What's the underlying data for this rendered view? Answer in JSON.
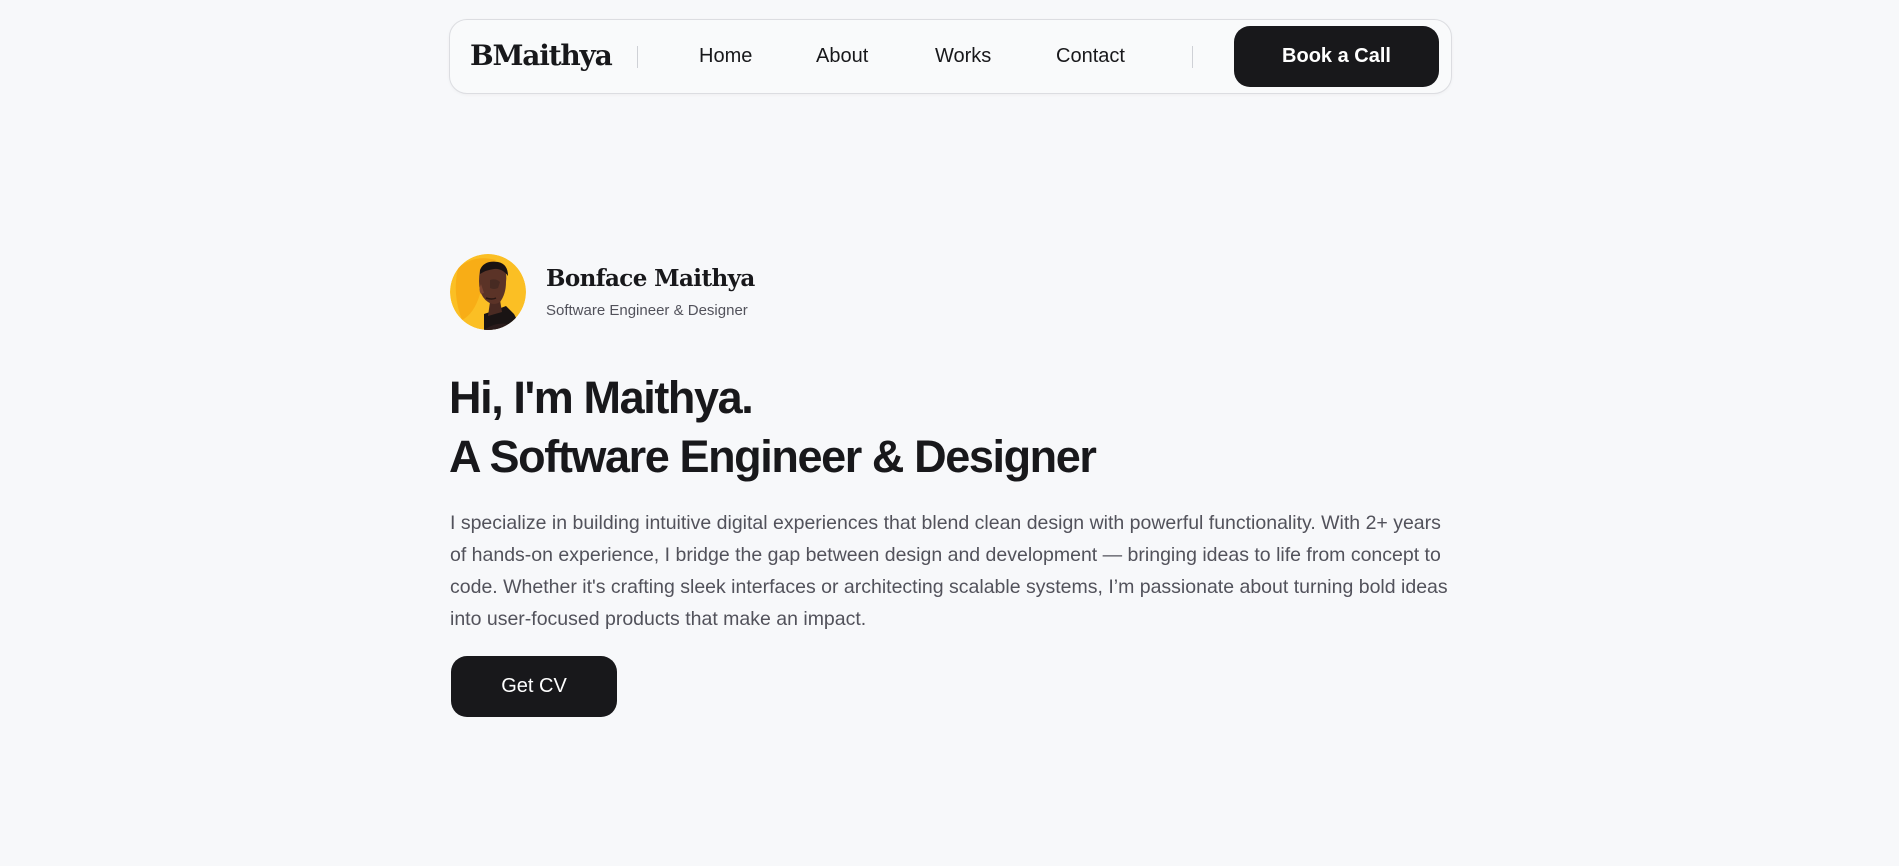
{
  "header": {
    "logo": "BMaithya",
    "nav": [
      "Home",
      "About",
      "Works",
      "Contact"
    ],
    "cta_label": "Book a Call"
  },
  "profile": {
    "name": "Bonface Maithya",
    "role": "Software Engineer & Designer",
    "avatar_bg": "#fbbf24"
  },
  "hero": {
    "line1": "Hi, I'm Maithya.",
    "line2": "A Software Engineer & Designer",
    "bio": "I specialize in building intuitive digital experiences that blend clean design with powerful functionality. With 2+ years of hands-on experience, I bridge the gap between design and development — bringing ideas to life from concept to code. Whether it's crafting sleek interfaces or architecting scalable systems, I’m passionate about turning bold ideas into user-focused products that make an impact.",
    "cv_label": "Get CV"
  },
  "colors": {
    "background": "#f7f8fa",
    "primary": "#18181b",
    "muted": "#52525b"
  }
}
